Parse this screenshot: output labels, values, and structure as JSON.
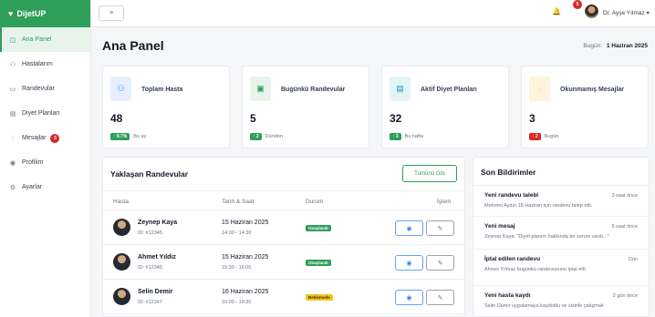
{
  "brand": {
    "name": "DijetUP",
    "icon": "heart-icon"
  },
  "sidebar": {
    "items": [
      {
        "label": "Ana Panel",
        "icon": "dashboard-icon",
        "active": true
      },
      {
        "label": "Hastalarım",
        "icon": "users-icon"
      },
      {
        "label": "Randevular",
        "icon": "calendar-icon"
      },
      {
        "label": "Diyet Planları",
        "icon": "clipboard-icon"
      },
      {
        "label": "Mesajlar",
        "icon": "chat-icon",
        "badge": "3"
      },
      {
        "label": "Profilim",
        "icon": "user-circle-icon"
      },
      {
        "label": "Ayarlar",
        "icon": "gear-icon"
      }
    ]
  },
  "topbar": {
    "menu_icon": "≡",
    "bell_icon": "🔔",
    "notification_count": "5",
    "user_name": "Dr. Ayşe Yılmaz ▾"
  },
  "page": {
    "title": "Ana Panel",
    "today_label": "Bugün:",
    "today_date": "1 Haziran 2025"
  },
  "stats": [
    {
      "label": "Toplam Hasta",
      "value": "48",
      "trend": "↑ 9.7%",
      "trend_text": "Bu ay",
      "trend_color": "#2e9e5b",
      "icon": "users-icon"
    },
    {
      "label": "Bugünkü Randevular",
      "value": "5",
      "trend": "↑ 2",
      "trend_text": "Dünden",
      "trend_color": "#2e9e5b",
      "icon": "calendar-check-icon"
    },
    {
      "label": "Aktif Diyet Planları",
      "value": "32",
      "trend": "↑ 3",
      "trend_text": "Bu hafta",
      "trend_color": "#2e9e5b",
      "icon": "clipboard-icon"
    },
    {
      "label": "Okunmamış Mesajlar",
      "value": "3",
      "trend": "↑ 2",
      "trend_text": "Bugün",
      "trend_color": "#dc2626",
      "icon": "chat-icon"
    }
  ],
  "appointments": {
    "title": "Yaklaşan Randevular",
    "view_all": "Tümünü Gör",
    "columns": [
      "Hasta",
      "Tarih & Saat",
      "Durum",
      "İşlem"
    ],
    "rows": [
      {
        "name": "Zeynep Kaya",
        "id": "ID: #12345",
        "date": "15 Haziran 2025",
        "time": "14:00 - 14:30",
        "status": "Onaylandı",
        "status_type": "ok"
      },
      {
        "name": "Ahmet Yıldız",
        "id": "ID: #12346",
        "date": "15 Haziran 2025",
        "time": "15:30 - 16:00",
        "status": "Onaylandı",
        "status_type": "ok"
      },
      {
        "name": "Selin Demir",
        "id": "ID: #12347",
        "date": "16 Haziran 2025",
        "time": "10:00 - 10:30",
        "status": "Beklemede",
        "status_type": "wait"
      }
    ]
  },
  "notifications": {
    "title": "Son Bildirimler",
    "items": [
      {
        "title": "Yeni randevu talebi",
        "time": "3 saat önce",
        "text": "Mehmet Aydın 18 Haziran için randevu talep etti."
      },
      {
        "title": "Yeni mesaj",
        "time": "5 saat önce",
        "text": "Zeynep Kaya: \"Diyet planım hakkında bir sorum vardı...\""
      },
      {
        "title": "İptal edilen randevu",
        "time": "Dün",
        "text": "Ahmet Yılmaz bugünkü randevusunu iptal etti."
      },
      {
        "title": "Yeni hasta kaydı",
        "time": "2 gün önce",
        "text": "Selin Demir uygulamaya kaydoldu ve sizinle çalışmak"
      }
    ]
  },
  "colors": {
    "brand": "#2e9e5b",
    "danger": "#dc2626",
    "warning": "#f5c518",
    "info": "#3b82f6"
  }
}
